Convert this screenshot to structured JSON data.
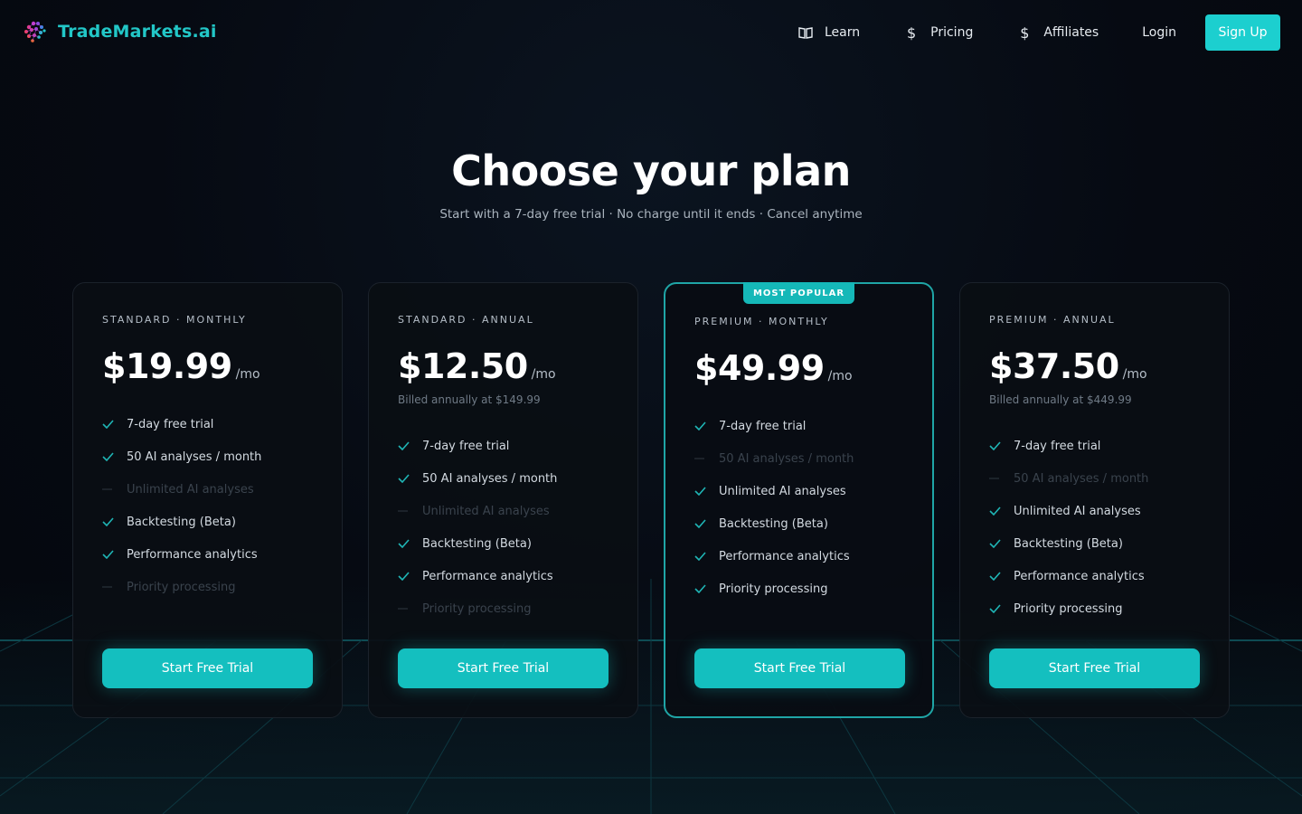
{
  "brand": {
    "name": "TradeMarkets.ai",
    "accent": "#22c7c7"
  },
  "nav": {
    "items": [
      {
        "label": "Learn",
        "icon": "book-icon"
      },
      {
        "label": "Pricing",
        "icon": "dollar-icon"
      },
      {
        "label": "Affiliates",
        "icon": "dollar-icon"
      }
    ],
    "login": "Login",
    "signup": "Sign Up"
  },
  "hero": {
    "title": "Choose your plan",
    "subtitle": "Start with a 7-day free trial · No charge until it ends · Cancel anytime"
  },
  "plans": [
    {
      "label": "STANDARD · MONTHLY",
      "price": "$19.99",
      "per": "/mo",
      "billed": "",
      "featured": false,
      "features": [
        {
          "text": "7-day free trial",
          "included": true
        },
        {
          "text": "50 AI analyses / month",
          "included": true
        },
        {
          "text": "Unlimited AI analyses",
          "included": false
        },
        {
          "text": "Backtesting (Beta)",
          "included": true
        },
        {
          "text": "Performance analytics",
          "included": true
        },
        {
          "text": "Priority processing",
          "included": false
        }
      ],
      "cta": "Start Free Trial"
    },
    {
      "label": "STANDARD · ANNUAL",
      "price": "$12.50",
      "per": "/mo",
      "billed": "Billed annually at $149.99",
      "featured": false,
      "features": [
        {
          "text": "7-day free trial",
          "included": true
        },
        {
          "text": "50 AI analyses / month",
          "included": true
        },
        {
          "text": "Unlimited AI analyses",
          "included": false
        },
        {
          "text": "Backtesting (Beta)",
          "included": true
        },
        {
          "text": "Performance analytics",
          "included": true
        },
        {
          "text": "Priority processing",
          "included": false
        }
      ],
      "cta": "Start Free Trial"
    },
    {
      "label": "PREMIUM · MONTHLY",
      "price": "$49.99",
      "per": "/mo",
      "billed": "",
      "featured": true,
      "badge": "MOST POPULAR",
      "features": [
        {
          "text": "7-day free trial",
          "included": true
        },
        {
          "text": "50 AI analyses / month",
          "included": false
        },
        {
          "text": "Unlimited AI analyses",
          "included": true
        },
        {
          "text": "Backtesting (Beta)",
          "included": true
        },
        {
          "text": "Performance analytics",
          "included": true
        },
        {
          "text": "Priority processing",
          "included": true
        }
      ],
      "cta": "Start Free Trial"
    },
    {
      "label": "PREMIUM · ANNUAL",
      "price": "$37.50",
      "per": "/mo",
      "billed": "Billed annually at $449.99",
      "featured": false,
      "features": [
        {
          "text": "7-day free trial",
          "included": true
        },
        {
          "text": "50 AI analyses / month",
          "included": false
        },
        {
          "text": "Unlimited AI analyses",
          "included": true
        },
        {
          "text": "Backtesting (Beta)",
          "included": true
        },
        {
          "text": "Performance analytics",
          "included": true
        },
        {
          "text": "Priority processing",
          "included": true
        }
      ],
      "cta": "Start Free Trial"
    }
  ]
}
